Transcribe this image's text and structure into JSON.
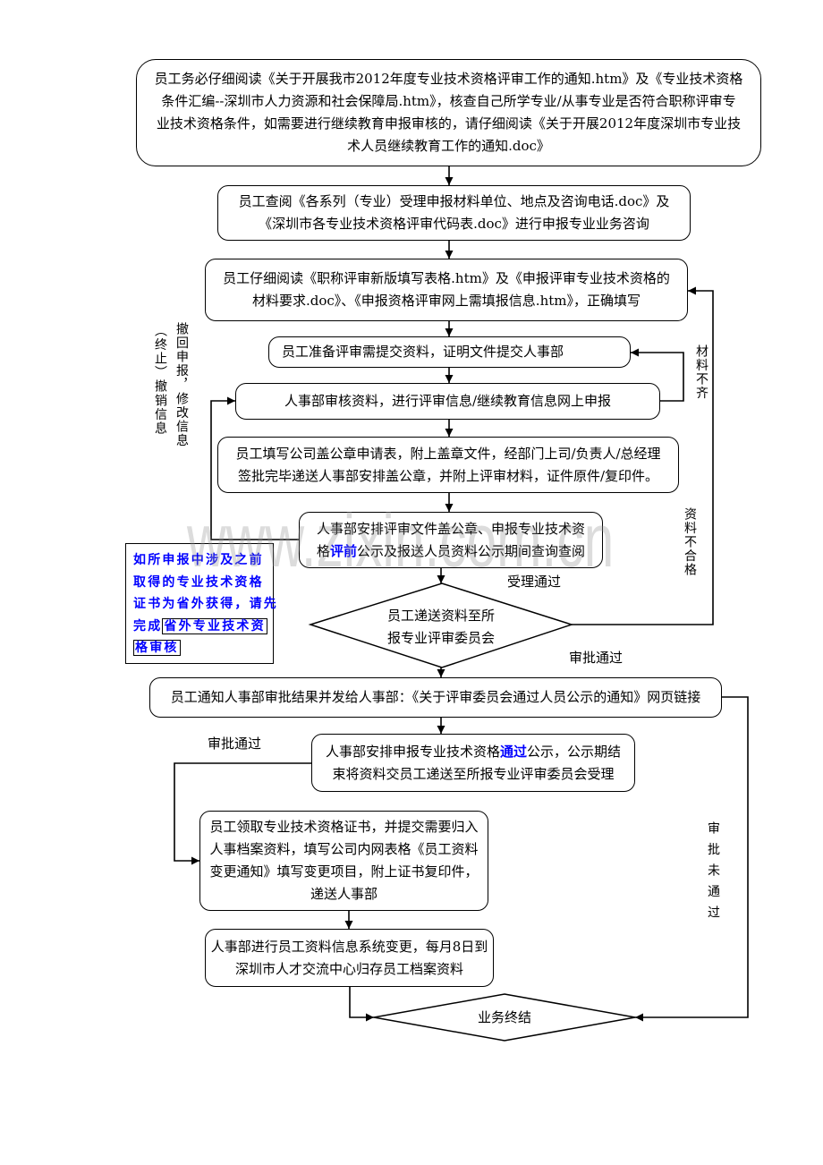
{
  "colors": {
    "highlight": "#0000ff",
    "stroke": "#000000"
  },
  "watermark": "www.zixin.com.cn",
  "steps": {
    "step1": {
      "lines": [
        "员工务必仔细阅读《关于开展我市2012年度专业技术资格评审工作的通知.htm》及《专业技术资格",
        "条件汇编--深圳市人力资源和社会保障局.htm》，核查自己所学专业/从事专业是否符合职称评审专",
        "业技术资格条件，如需要进行继续教育申报审核的，请仔细阅读《关于开展2012年度深圳市专业技",
        "术人员继续教育工作的通知.doc》"
      ]
    },
    "step2": {
      "lines": [
        "员工查阅《各系列（专业）受理申报材料单位、地点及咨询电话.doc》及",
        "《深圳市各专业技术资格评审代码表.doc》进行申报专业业务咨询"
      ]
    },
    "step3": {
      "lines": [
        "员工仔细阅读《职称评审新版填写表格.htm》及《申报评审专业技术资格的",
        "材料要求.doc》、《申报资格评审网上需填报信息.htm》，正确填写"
      ]
    },
    "step4": {
      "lines": [
        "员工准备评审需提交资料，证明文件提交人事部"
      ]
    },
    "step5": {
      "lines": [
        "人事部审核资料，进行评审信息/继续教育信息网上申报"
      ]
    },
    "step6": {
      "lines": [
        "员工填写公司盖公章申请表，附上盖章文件，经部门上司/负责人/总经理",
        "签批完毕递送人事部安排盖公章，并附上评审材料，证件原件/复印件。"
      ]
    },
    "step7": {
      "line1": "人事部安排评审文件盖公章、申报专业技术资",
      "line2_before": "格",
      "line2_highlight": "评前",
      "line2_after": "公示及报送人员资料公示期间查询查阅"
    },
    "decision1": {
      "lines": [
        "员工递送资料至所",
        "报专业评审委员会"
      ]
    },
    "step8": {
      "lines": [
        "员工通知人事部审批结果并发给人事部：《关于评审委员会通过人员公示的通知》网页链接"
      ]
    },
    "step9": {
      "line1_before": "人事部安排申报专业技术资格",
      "line1_highlight": "通过",
      "line1_after": "公示，公示期结",
      "line2": "束将资料交员工递送至所报专业评审委员会受理"
    },
    "step10": {
      "lines": [
        "员工领取专业技术资格证书，并提交需要归入",
        "人事档案资料，填写公司内网表格《员工资料",
        "变更通知》填写变更项目，附上证书复印件，",
        "递送人事部"
      ]
    },
    "step11": {
      "lines": [
        "人事部进行员工资料信息系统变更，每月8日到",
        "深圳市人才交流中心归存员工档案资料"
      ]
    },
    "end": {
      "label": "业务终结"
    }
  },
  "labels": {
    "terminate": "（终止）撤销信息",
    "withdraw": "撤回申报，修改信息",
    "material_incomplete": "材料不齐",
    "unqualified": "资料不合格",
    "accepted": "受理通过",
    "approved_right": "审批通过",
    "approved_left": "审批通过",
    "not_approved": "审批未通过"
  },
  "note": {
    "lines": [
      "如所申报中涉及之前",
      "取得的专业技术资格",
      "证书为省外获得，请先"
    ],
    "line4_prefix": "完成",
    "link_part1": "省外专业技术资",
    "link_part2": "格审核"
  }
}
